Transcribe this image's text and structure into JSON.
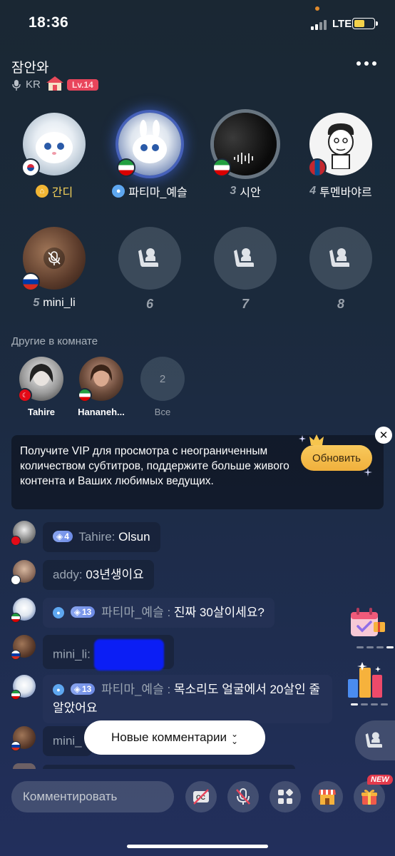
{
  "status_bar": {
    "time": "18:36",
    "network": "LTE"
  },
  "room": {
    "title": "잠안와",
    "region": "KR",
    "level": "Lv.14"
  },
  "seats": [
    {
      "num": "",
      "name": "간디",
      "role": "host",
      "flag": "KR"
    },
    {
      "num": "",
      "name": "파티마_예슬",
      "role": "user",
      "flag": "IR"
    },
    {
      "num": "3",
      "name": "시안",
      "flag": "IR"
    },
    {
      "num": "4",
      "name": "투멘바야르",
      "flag": "MN"
    },
    {
      "num": "5",
      "name": "mini_li",
      "flag": "RU",
      "muted": true
    },
    {
      "num": "6"
    },
    {
      "num": "7"
    },
    {
      "num": "8"
    }
  ],
  "others": {
    "title": "Другие в комнате",
    "users": [
      {
        "name": "Tahire",
        "flag": "TR"
      },
      {
        "name": "Hananeh...",
        "flag": "IR"
      }
    ],
    "count": "2",
    "all_label": "Все"
  },
  "vip_banner": {
    "text": "Получите VIP для просмотра с неограниченным количеством субтитров, поддержите больше живого контента и Ваших любимых ведущих.",
    "button": "Обновить"
  },
  "chat": [
    {
      "level": "4",
      "name": "Tahire:",
      "text": "Olsun",
      "flag": "TR"
    },
    {
      "name": "addy:",
      "text": "03년생이요",
      "flag": "KR"
    },
    {
      "level": "13",
      "name": "파티마_예슬 :",
      "text": "진짜 30살이세요?",
      "flag": "IR"
    },
    {
      "name": "mini_li:",
      "text": "",
      "flag": "RU"
    },
    {
      "level": "13",
      "name": "파티마_예슬 :",
      "text": "목소리도 얼굴에서 20살인 줄 알았어요",
      "flag": "IR"
    },
    {
      "name": "mini_",
      "text": "",
      "flag": "RU"
    }
  ],
  "new_comments_label": "Новые комментарии",
  "comment_placeholder": "Комментировать",
  "new_badge": "NEW",
  "colors": {
    "accent": "#f0b03c",
    "level_badge": "#e8455b",
    "background": "#1d2c48"
  }
}
